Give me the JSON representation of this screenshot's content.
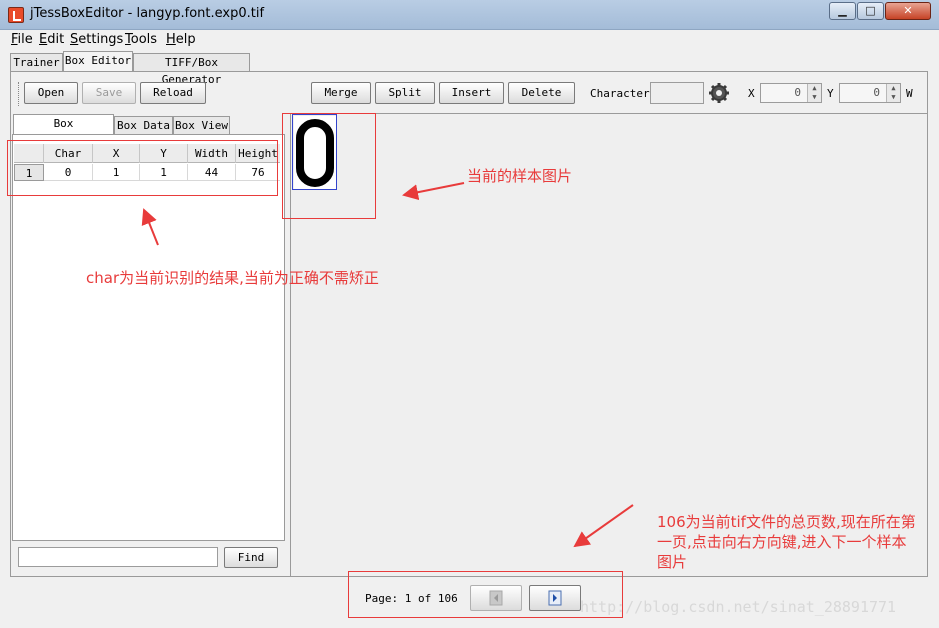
{
  "window": {
    "title": "jTessBoxEditor - langyp.font.exp0.tif",
    "min_glyph": "▁",
    "max_glyph": "□",
    "close_glyph": "✕"
  },
  "menu": {
    "file": {
      "key": "F",
      "rest": "ile"
    },
    "edit": {
      "key": "E",
      "rest": "dit"
    },
    "settings": {
      "key": "S",
      "rest": "ettings"
    },
    "tools": {
      "key": "T",
      "rest": "ools"
    },
    "help": {
      "key": "H",
      "rest": "elp"
    }
  },
  "tabs": {
    "trainer": "Trainer",
    "box_editor": "Box Editor",
    "tiff_box_generator": "TIFF/Box Generator"
  },
  "toolbar": {
    "open": "Open",
    "save": "Save",
    "reload": "Reload",
    "merge": "Merge",
    "split": "Split",
    "insert": "Insert",
    "delete": "Delete",
    "character_label": "Character",
    "x_label": "X",
    "x_value": "0",
    "y_label": "Y",
    "y_value": "0",
    "w_label": "W"
  },
  "side_tabs": {
    "box_coordinates": "Box Coordinates",
    "box_data": "Box Data",
    "box_view": "Box View"
  },
  "table": {
    "headers": [
      "Char",
      "X",
      "Y",
      "Width",
      "Height"
    ],
    "rows": [
      {
        "num": "1",
        "cells": [
          "0",
          "1",
          "1",
          "44",
          "76"
        ]
      }
    ]
  },
  "find_label": "Find",
  "pager": {
    "text": "Page: 1 of 106"
  },
  "annotations": {
    "sample_image": "当前的样本图片",
    "char_result": "char为当前识别的结果,当前为正确不需矫正",
    "page_line1": "106为当前tif文件的总页数,现在所在第",
    "page_line2": "一页,点击向右方向键,进入下一个样本",
    "page_line3": "图片"
  },
  "watermark": "http://blog.csdn.net/sinat_28891771",
  "colors": {
    "annotation": "#e83b3b",
    "box_outline": "#3344cc"
  }
}
